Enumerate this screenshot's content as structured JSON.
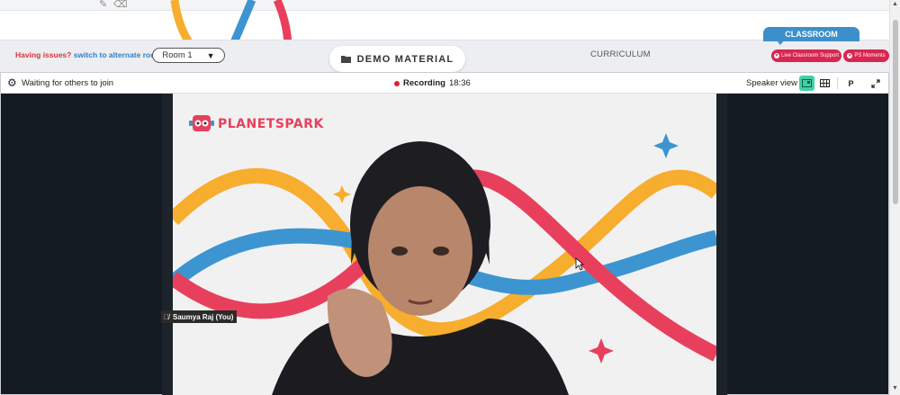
{
  "top_strip": {
    "icons": [
      "pencil-icon",
      "eraser-icon"
    ]
  },
  "header": {
    "issues_text": "Having issues?",
    "switch_link": "switch to alternate room",
    "room_selector": {
      "value": "Room 1",
      "caret": "▼"
    },
    "demo_material_label": "DEMO MATERIAL",
    "curriculum_label": "CURRICULUM",
    "classroom_tab": "CLASSROOM",
    "live_support_label": "Live Classroom Support",
    "ps_moments_label": "PS Moments"
  },
  "meeting": {
    "status_text": "Waiting for others to join",
    "recording_label": "Recording",
    "recording_time": "18:36",
    "view_label": "Speaker view",
    "p_button": "P",
    "participant_name": "Saumya Raj (You)",
    "brand_logo_text": "PLANETSPARK"
  },
  "colors": {
    "accent_blue": "#3d8fcb",
    "alert_red": "#e0303b",
    "pill_red": "#d8264f",
    "active_view": "#43d1a3",
    "wave_red": "#e8405c",
    "wave_yellow": "#f7ad2d",
    "wave_blue": "#3c95d0"
  }
}
